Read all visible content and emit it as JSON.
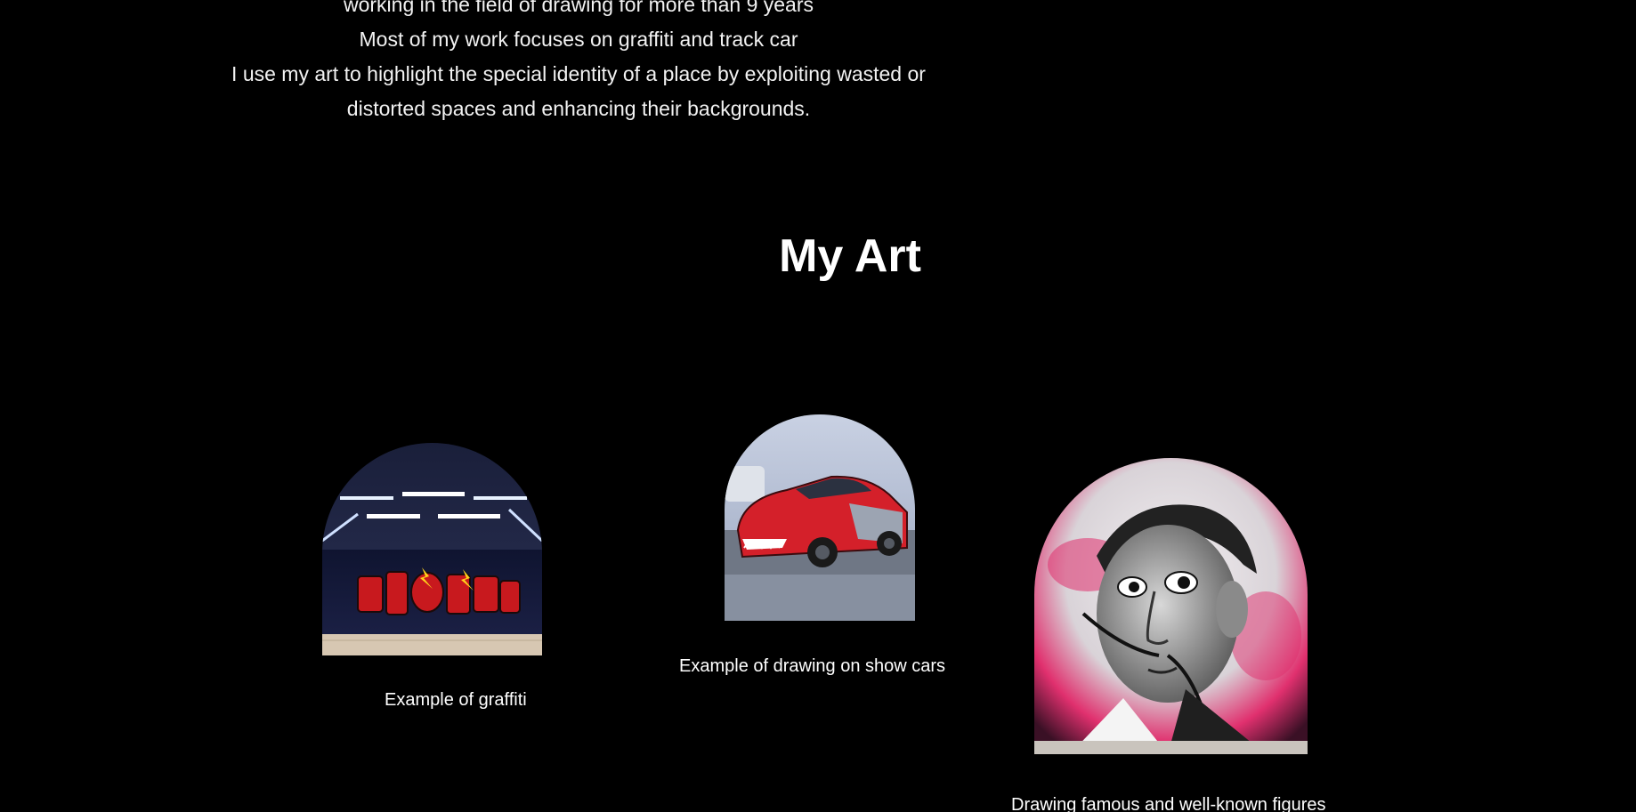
{
  "intro": {
    "lines": [
      "working in the field of drawing for more than 9 years",
      "Most of my work focuses on graffiti and track car",
      "I use my art to highlight the special identity of a place by exploiting wasted or",
      "distorted spaces and enhancing their backgrounds."
    ]
  },
  "section": {
    "title": "My Art"
  },
  "art_items": [
    {
      "caption": "Example of graffiti",
      "image": "graffiti-mural-photo"
    },
    {
      "caption": "Example of drawing on show cars",
      "image": "painted-show-car-photo"
    },
    {
      "caption": "Drawing famous and well-known figures",
      "image": "mural-portrait-photo"
    }
  ],
  "colors": {
    "background": "#000000",
    "text": "#ffffff",
    "graffiti_red": "#c8191e",
    "car_red": "#d4202a",
    "portrait_pink": "#e0306e"
  }
}
